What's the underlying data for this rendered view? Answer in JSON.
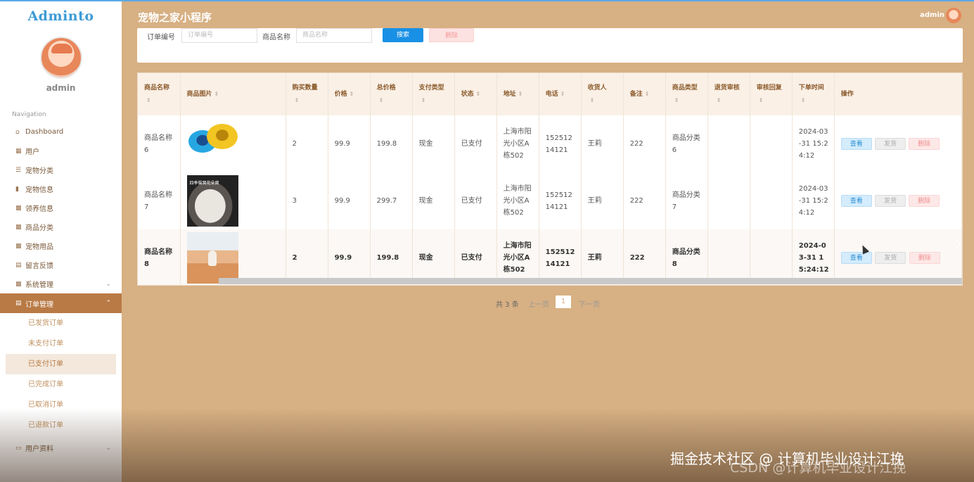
{
  "sidebar": {
    "logo": "Adminto",
    "user_name": "admin",
    "nav_caption": "Navigation",
    "items": [
      {
        "label": "Dashboard",
        "icon": "⌂"
      },
      {
        "label": "用户",
        "icon": "▦"
      },
      {
        "label": "宠物分类",
        "icon": "☰"
      },
      {
        "label": "宠物信息",
        "icon": "▮"
      },
      {
        "label": "领养信息",
        "icon": "▩"
      },
      {
        "label": "商品分类",
        "icon": "▩"
      },
      {
        "label": "宠物用品",
        "icon": "▩"
      },
      {
        "label": "留言反馈",
        "icon": "▤"
      },
      {
        "label": "系统管理",
        "icon": "▩",
        "chevron": "⌄"
      },
      {
        "label": "订单管理",
        "icon": "▤",
        "chevron": "⌃"
      },
      {
        "label": "用户资料",
        "icon": "▭",
        "chevron": "⌄"
      }
    ],
    "sub_items": [
      "已发货订单",
      "未支付订单",
      "已支付订单",
      "已完成订单",
      "已取消订单",
      "已退款订单"
    ]
  },
  "header": {
    "title": "宠物之家小程序",
    "user": "admin"
  },
  "search": {
    "order_label": "订单编号",
    "order_placeholder": "订单编号",
    "product_label": "商品名称",
    "product_placeholder": "商品名称",
    "search_btn": "搜索",
    "delete_btn": "删除"
  },
  "table": {
    "headers": [
      "商品名称",
      "商品图片",
      "购买数量",
      "价格",
      "总价格",
      "支付类型",
      "状态",
      "地址",
      "电话",
      "收货人",
      "备注",
      "商品类型",
      "退货审核",
      "审核回复",
      "下单时间",
      "操作"
    ],
    "sort_icon": "⇕",
    "rows": [
      {
        "name": "商品名称6",
        "qty": "2",
        "price": "99.9",
        "total": "199.8",
        "pay": "现金",
        "status": "已支付",
        "addr": "上海市阳光小区A栋502",
        "phone": "15251214121",
        "receiver": "王莉",
        "note": "222",
        "ptype": "商品分类6",
        "refund": "",
        "reply": "",
        "time": "2024-03-31 15:24:12"
      },
      {
        "name": "商品名称7",
        "qty": "3",
        "price": "99.9",
        "total": "299.7",
        "pay": "现金",
        "status": "已支付",
        "addr": "上海市阳光小区A栋502",
        "phone": "15251214121",
        "receiver": "王莉",
        "note": "222",
        "ptype": "商品分类7",
        "refund": "",
        "reply": "",
        "time": "2024-03-31 15:24:12",
        "img_caption": "四季猫窝花朵窝"
      },
      {
        "name": "商品名称8",
        "qty": "2",
        "price": "99.9",
        "total": "199.8",
        "pay": "现金",
        "status": "已支付",
        "addr": "上海市阳光小区A栋502",
        "phone": "15251214121",
        "receiver": "王莉",
        "note": "222",
        "ptype": "商品分类8",
        "refund": "",
        "reply": "",
        "time": "2024-03-31 15:24:12"
      }
    ],
    "ops": {
      "view": "查看",
      "ship": "发货",
      "delete": "删除"
    }
  },
  "pagination": {
    "total": "共 3 条",
    "prev": "上一页",
    "page": "1",
    "next": "下一页"
  },
  "carousel": {
    "left": "‹",
    "right": "›"
  },
  "watermark": {
    "line1": "掘金技术社区 @ 计算机毕业设计江挽",
    "line2": "CSDN @计算机毕业设计江挽"
  }
}
